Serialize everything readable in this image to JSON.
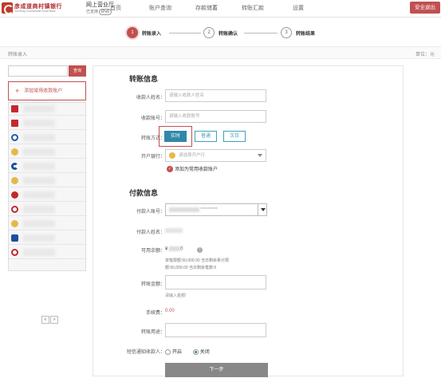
{
  "header": {
    "logo_cn": "彦成道商村镇银行",
    "logo_en": "Yucheng Commercial Rural Bank",
    "portal_title": "网上营业厅",
    "ipv6_prefix": "已支持",
    "ipv6_badge": "IPv6",
    "nav": [
      "首页",
      "账户查询",
      "存款储蓄",
      "转账汇款",
      "设置"
    ],
    "logout_label": "安全退出"
  },
  "steps": [
    {
      "number": "1",
      "label": "转账录入"
    },
    {
      "number": "2",
      "label": "转账确认"
    },
    {
      "number": "3",
      "label": "转账结果"
    }
  ],
  "breadcrumb": {
    "current": "转账录入",
    "unit_label": "单位：元"
  },
  "left_panel": {
    "search_button": "查询",
    "add_payee": "添加常用收款账户",
    "pager": [
      "<",
      ">"
    ]
  },
  "form": {
    "payee_section": "转账信息",
    "payee_name_label": "收款人姓名：",
    "payee_name_placeholder": "请输入收款人姓名",
    "payee_account_label": "收款账号：",
    "payee_account_placeholder": "请输入收款账号",
    "mode_label": "转账方式：",
    "modes": [
      "实时",
      "普通",
      "次日"
    ],
    "bank_label": "开户银行：",
    "bank_placeholder": "请选择开户行",
    "save_payee": "添加为常用收款账户",
    "payer_section": "付款信息",
    "payer_account_label": "付款人账号：",
    "payer_account_value": "**********",
    "payer_name_label": "付款人姓名：",
    "balance_label": "可用余额：",
    "balance_prefix": "¥",
    "balance_suffix": "0",
    "limit_line1": "单笔限额:50,000.00 当日剩余累计限",
    "limit_line2": "额:50,000.00 当日剩余笔数:6",
    "amount_label": "转账金额：",
    "amount_hint": "请输入金额!",
    "fee_label": "手续费：",
    "fee_value": "0.00",
    "purpose_label": "转账用途：",
    "sms_label": "短信通知收款人：",
    "sms_on": "开启",
    "sms_off": "关闭",
    "next_button": "下一步"
  }
}
